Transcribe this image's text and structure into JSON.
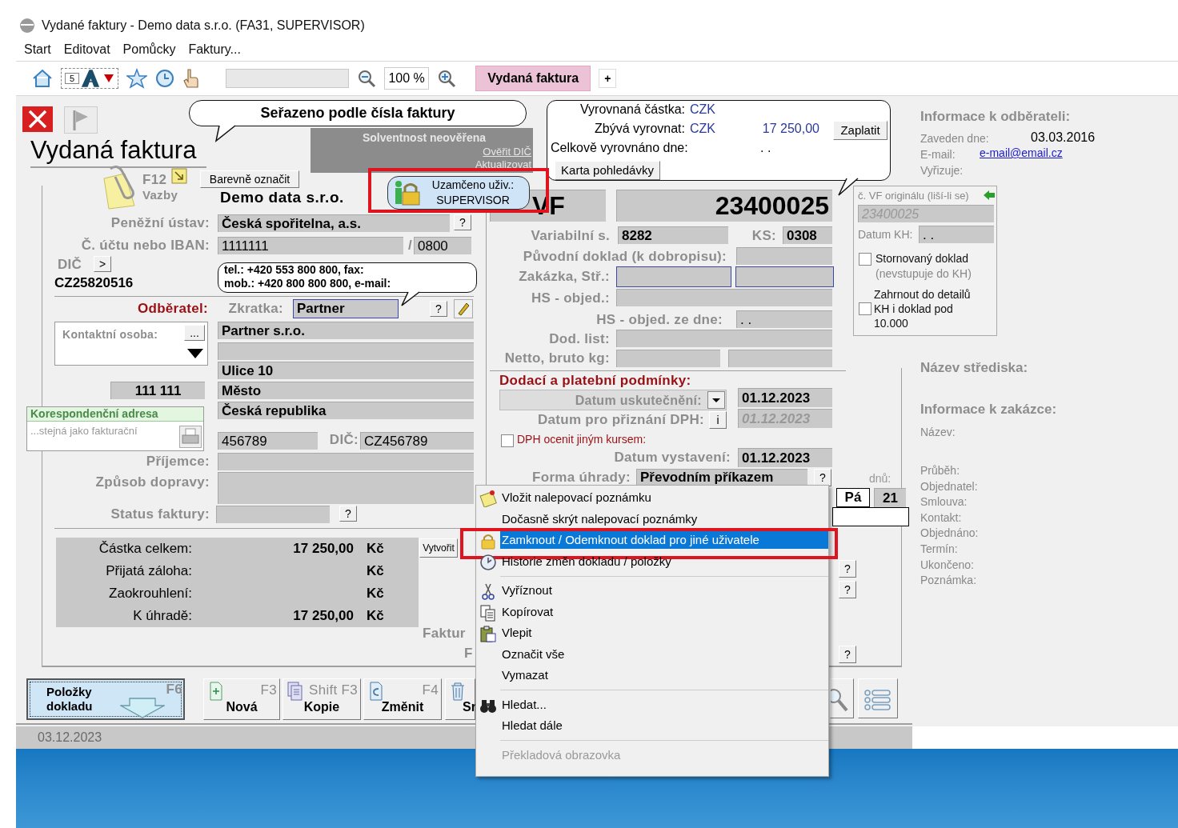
{
  "window": {
    "title": "Vydané faktury - Demo data s.r.o. (FA31, SUPERVISOR)"
  },
  "menu": [
    {
      "label": "Start"
    },
    {
      "label": "Editovat"
    },
    {
      "label": "Pomůcky"
    },
    {
      "label": "Faktury..."
    }
  ],
  "toolbar": {
    "counter": "5",
    "zoom": "100 %",
    "tabs": [
      {
        "label": "Vydaná faktura",
        "selected": true
      },
      {
        "label": "+",
        "selected": false
      }
    ]
  },
  "header": {
    "sort_note": "Seřazeno podle čísla faktury",
    "title": "Vydaná faktura",
    "links_key": "F12",
    "links_label": "Vazby",
    "color_button": "Barevně označit",
    "solvency": {
      "title": "Solventnost neověřena",
      "links": [
        "Ověřit DIČ",
        "Aktualizovat"
      ]
    },
    "lock": {
      "label": "Uzamčeno uživ.:",
      "user": "SUPERVISOR"
    }
  },
  "settlement": {
    "rows": [
      {
        "label": "Vyrovnaná částka:",
        "currency": "CZK"
      },
      {
        "label": "Zbývá vyrovnat:",
        "currency": "CZK",
        "amount": "17 250,00"
      }
    ],
    "pay_button": "Zaplatit",
    "settled_label": "Celkově vyrovnáno dne:",
    "settled_date": ". .",
    "card_button": "Karta pohledávky"
  },
  "supplier": {
    "name": "Demo data s.r.o.",
    "bank_label": "Peněžní ústav:",
    "bank": "Česká spořitelna, a.s.",
    "account_label": "Č. účtu nebo IBAN:",
    "account": "1111111",
    "bank_code_separator": "/",
    "bank_code": "0800",
    "vat_label": "DIČ",
    "vat_button": ">",
    "vat": "CZ25820516",
    "contact_note": [
      "tel.: +420 553 800 800, fax:",
      "mob.: +420 800 800 800, e-mail:"
    ]
  },
  "customer": {
    "heading": "Odběratel:",
    "short_label": "Zkratka:",
    "short": "Partner",
    "contact_label": "Kontaktní osoba:",
    "contact_button": "...",
    "name": "Partner s.r.o.",
    "street": "Ulice 10",
    "zip": "111 111",
    "city": "Město",
    "country": "Česká republika",
    "correspondence": {
      "heading": "Korespondenční adresa",
      "text": "...stejná jako fakturační"
    },
    "id": "456789",
    "vat_label": "DIČ:",
    "vat": "CZ456789",
    "recipient_label": "Příjemce:",
    "transport_label": "Způsob dopravy:",
    "status_label": "Status faktury:"
  },
  "totals": [
    {
      "label": "Částka celkem:",
      "amount": "17 250,00",
      "currency": "Kč"
    },
    {
      "label": "Přijatá záloha:",
      "currency": "Kč"
    },
    {
      "label": "Zaokrouhlení:",
      "currency": "Kč"
    },
    {
      "label": "K úhradě:",
      "amount": "17 250,00",
      "currency": "Kč"
    }
  ],
  "create_button": "Vytvořit",
  "cut_labels": [
    "Faktur",
    "F"
  ],
  "help_buttons": [
    "?",
    "?",
    "?",
    "?",
    "?",
    "?",
    "?"
  ],
  "document": {
    "prefix": "VF",
    "number": "23400025",
    "variable_label": "Variabilní s.",
    "variable": "8282",
    "constant_label": "KS:",
    "constant": "0308",
    "original_label": "Původní doklad (k dobropisu):",
    "order_label": "Zakázka, Stř.:",
    "po_label": "HS - objed.:",
    "po_date_label": "HS - objed. ze dne:",
    "po_date": ". .",
    "delivery_note_label": "Dod. list:",
    "weight_label": "Netto, bruto kg:"
  },
  "terms": {
    "heading": "Dodací a platební podmínky:",
    "supply_label": "Datum uskutečnění:",
    "supply_date": "01.12.2023",
    "vat_date_label": "Datum pro přiznání DPH:",
    "info_button": "i",
    "vat_date": "01.12.2023",
    "other_rate": {
      "label": "DPH ocenit jiným kursem:",
      "checked": false
    },
    "issue_label": "Datum vystavení:",
    "issue_date": "01.12.2023",
    "payment_label": "Forma úhrady:",
    "payment": "Převodním příkazem",
    "days_label": "dnů:",
    "weekday": "Pá",
    "days": "21"
  },
  "original": {
    "label": "č. VF originálu (liší-li se)",
    "number": "23400025",
    "vat_report_label": "Datum KH:",
    "vat_report_date": ". .",
    "options": [
      {
        "label": "Stornovaný doklad",
        "note": "(nevstupuje do KH)",
        "checked": false
      },
      {
        "label": "Zahrnout do detailů KH i doklad pod 10.000",
        "checked": false
      }
    ]
  },
  "customer_info": {
    "heading": "Informace k odběrateli:",
    "rows": [
      {
        "label": "Zaveden dne:",
        "value": "03.03.2016"
      },
      {
        "label": "E-mail:",
        "link": "e-mail@email.cz"
      },
      {
        "label": "Vyřizuje:"
      }
    ],
    "centre_heading": "Název střediska:",
    "order_heading": "Informace k zakázce:",
    "order_fields": [
      "Název:",
      "Průběh:",
      "Objednatel:",
      "Smlouva:",
      "Kontakt:",
      "Objednáno:",
      "Termín:",
      "Ukončeno:",
      "Poznámka:"
    ]
  },
  "buttons": [
    {
      "label": "Položky dokladu",
      "key": "F6"
    },
    {
      "label": "Nová",
      "key": "F3"
    },
    {
      "label": "Kopie",
      "key": "Shift F3"
    },
    {
      "label": "Změnit",
      "key": "F4"
    },
    {
      "label": "Sr"
    }
  ],
  "status_bar": {
    "date": "03.12.2023"
  },
  "context_menu": [
    {
      "kind": "item",
      "label": "Vložit nalepovací poznámku",
      "selected": false,
      "disabled": false
    },
    {
      "kind": "item",
      "label": "Dočasně skrýt nalepovací poznámky",
      "selected": false,
      "disabled": false
    },
    {
      "kind": "item",
      "label": "Zamknout / Odemknout doklad pro jiné uživatele",
      "selected": true,
      "disabled": false
    },
    {
      "kind": "item",
      "label": "Historie změn dokladu / položky",
      "selected": false,
      "disabled": false
    },
    {
      "kind": "separator"
    },
    {
      "kind": "item",
      "label": "Vyříznout",
      "selected": false,
      "disabled": false
    },
    {
      "kind": "item",
      "label": "Kopírovat",
      "selected": false,
      "disabled": false
    },
    {
      "kind": "item",
      "label": "Vlepit",
      "selected": false,
      "disabled": false
    },
    {
      "kind": "item",
      "label": "Označit vše",
      "selected": false,
      "disabled": false
    },
    {
      "kind": "item",
      "label": "Vymazat",
      "selected": false,
      "disabled": false
    },
    {
      "kind": "separator"
    },
    {
      "kind": "item",
      "label": "Hledat...",
      "selected": false,
      "disabled": false
    },
    {
      "kind": "item",
      "label": "Hledat dále",
      "selected": false,
      "disabled": false
    },
    {
      "kind": "separator"
    },
    {
      "kind": "item",
      "label": "Překladová obrazovka",
      "selected": false,
      "disabled": true
    }
  ]
}
